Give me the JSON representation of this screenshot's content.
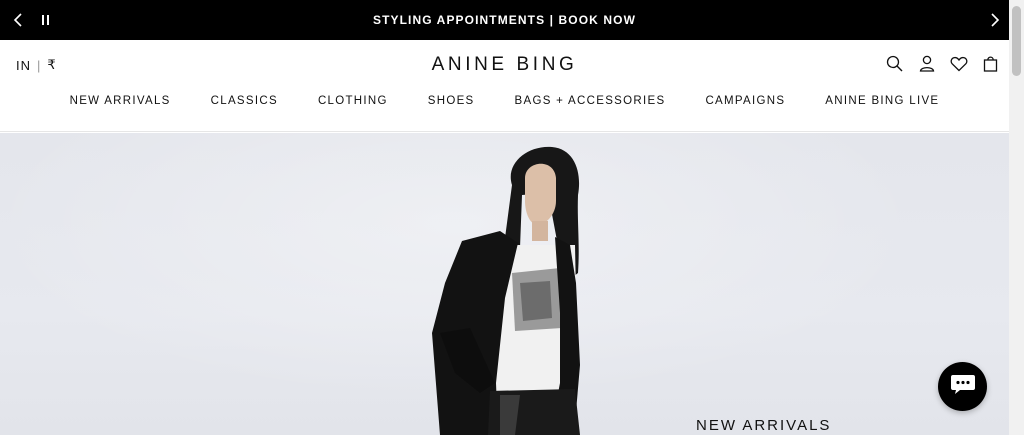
{
  "announcement": {
    "message": "STYLING APPOINTMENTS | BOOK NOW",
    "prev_icon": "chevron-left-icon",
    "pause_icon": "pause-icon",
    "next_icon": "chevron-right-icon"
  },
  "header": {
    "locale_country": "IN",
    "locale_currency": "₹",
    "logo": "ANINE BING",
    "icons": [
      "search-icon",
      "account-icon",
      "wishlist-icon",
      "cart-icon"
    ]
  },
  "nav": {
    "items": [
      {
        "label": "NEW ARRIVALS"
      },
      {
        "label": "CLASSICS"
      },
      {
        "label": "CLOTHING"
      },
      {
        "label": "SHOES"
      },
      {
        "label": "BAGS + ACCESSORIES"
      },
      {
        "label": "CAMPAIGNS"
      },
      {
        "label": "ANINE BING LIVE"
      }
    ]
  },
  "hero": {
    "title": "NEW ARRIVALS",
    "image": "model-in-black-blazer-photo"
  },
  "chat": {
    "icon": "chat-bubble-icon"
  },
  "colors": {
    "announcement_bg": "#000000",
    "hero_bg": "#e6e8ee",
    "text": "#111111"
  }
}
